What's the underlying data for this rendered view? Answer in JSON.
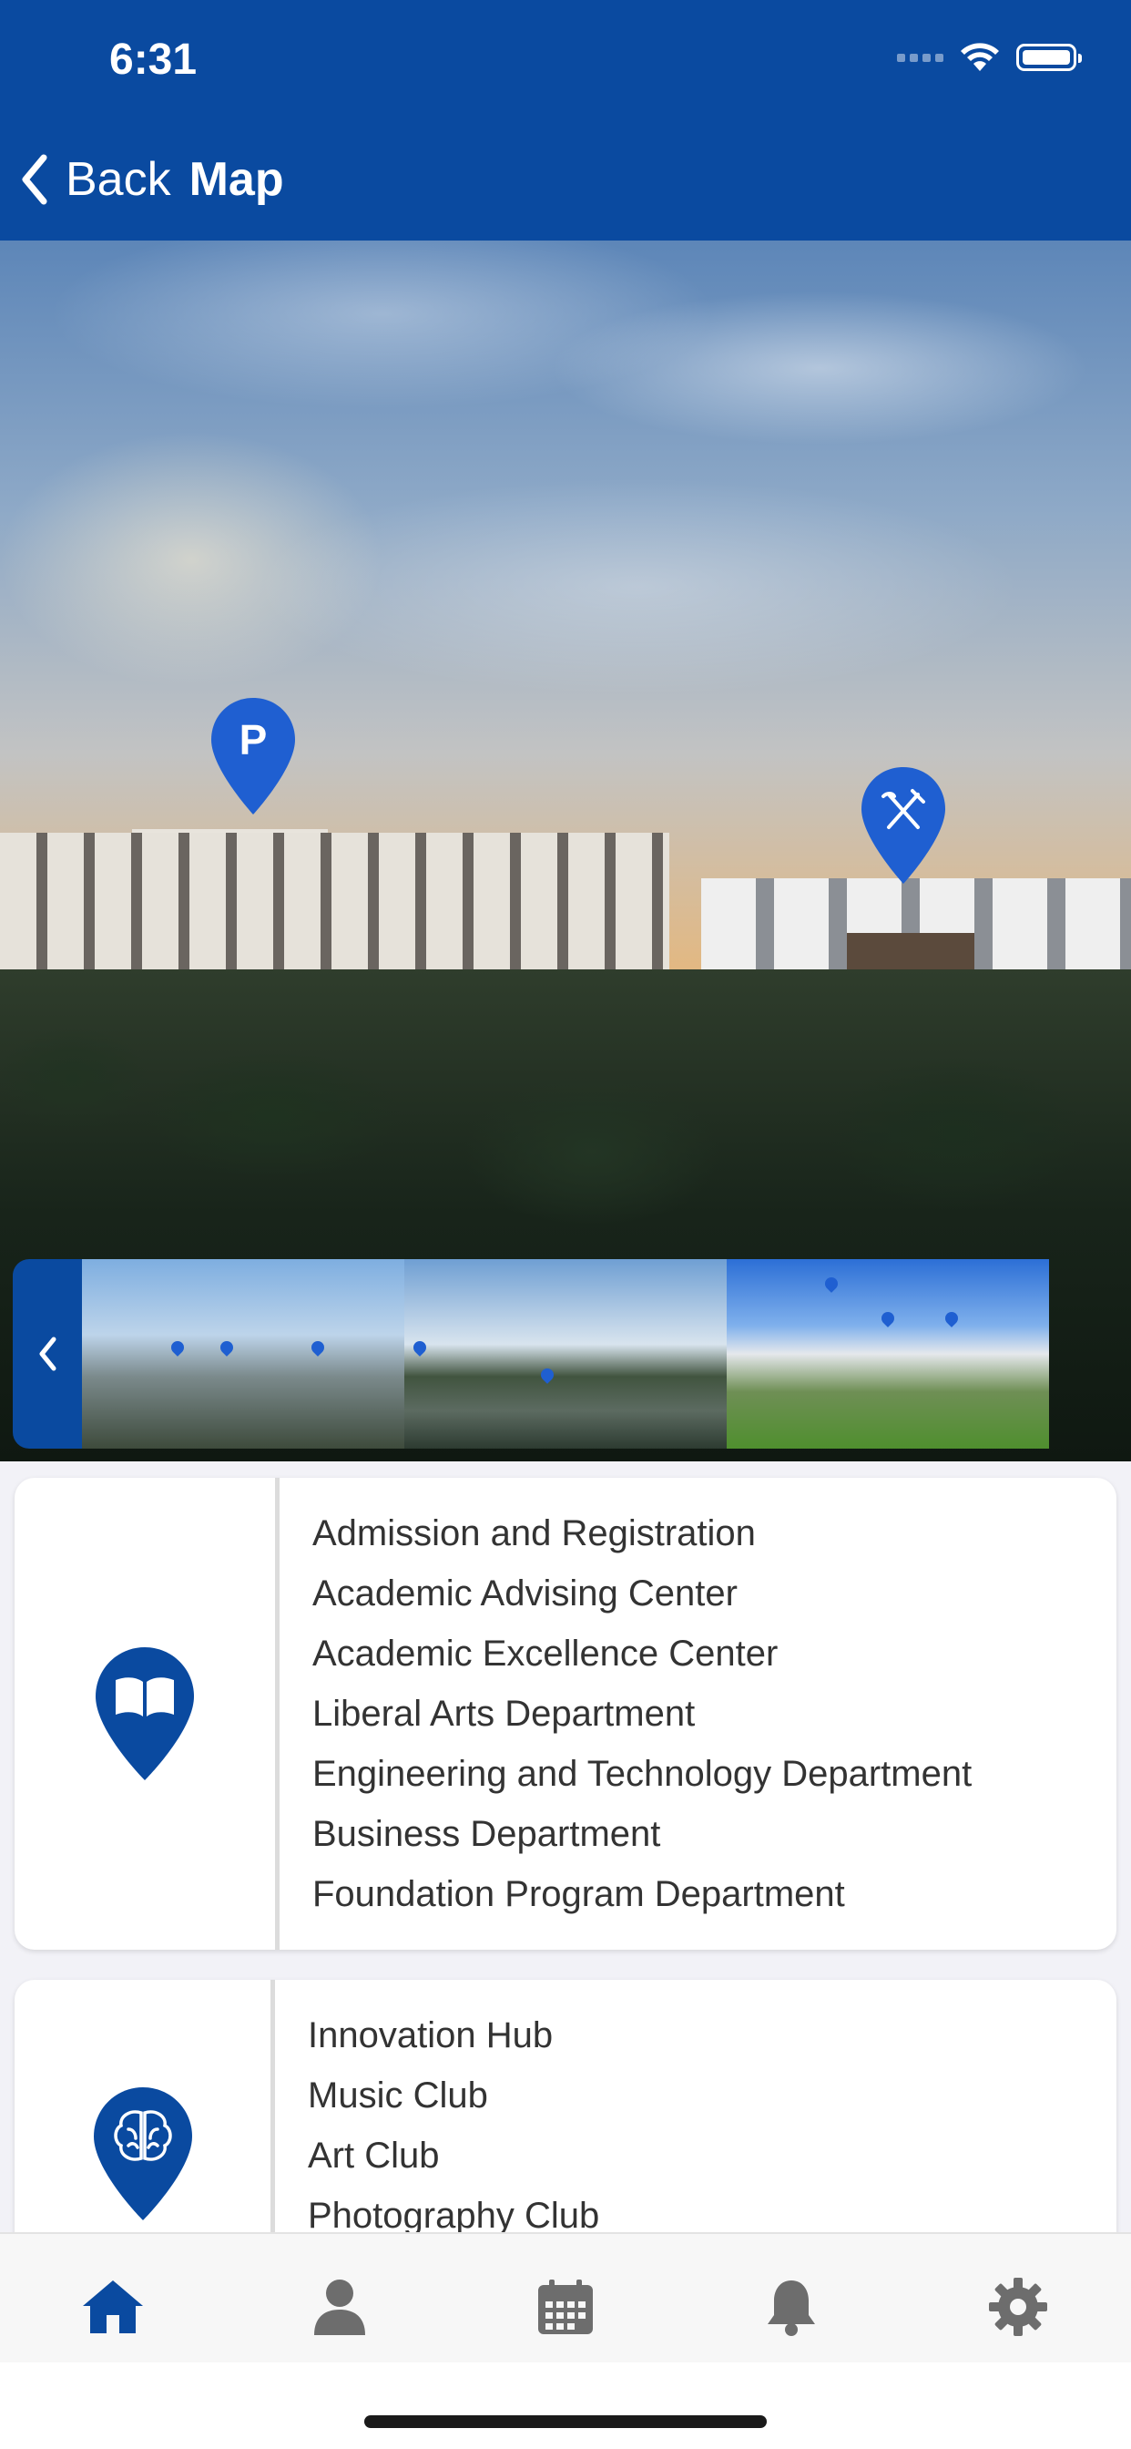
{
  "status_bar": {
    "time": "6:31"
  },
  "nav": {
    "back_label": "Back",
    "title": "Map"
  },
  "hero": {
    "pins": [
      {
        "icon": "parking-pin-icon",
        "label": "P"
      },
      {
        "icon": "dining-pin-icon"
      }
    ]
  },
  "thumbnails": [
    {
      "name": "campus-aerial-view"
    },
    {
      "name": "lake-view"
    },
    {
      "name": "lawn-view"
    }
  ],
  "cards": [
    {
      "icon": "book-pin-icon",
      "items": [
        "Admission and Registration",
        "Academic Advising Center",
        "Academic Excellence Center",
        "Liberal Arts Department",
        "Engineering and Technology Department",
        "Business Department",
        "Foundation Program Department"
      ]
    },
    {
      "icon": "brain-pin-icon",
      "items": [
        "Innovation Hub",
        "Music Club",
        "Art Club",
        "Photography Club"
      ]
    }
  ],
  "tab_bar": {
    "tabs": [
      "home-icon",
      "profile-icon",
      "calendar-icon",
      "bell-icon",
      "gear-icon"
    ],
    "active": "home-icon"
  },
  "colors": {
    "primary": "#0a4aa0",
    "pin": "#1f5fd1",
    "tab_inactive": "#6d6d6d"
  }
}
